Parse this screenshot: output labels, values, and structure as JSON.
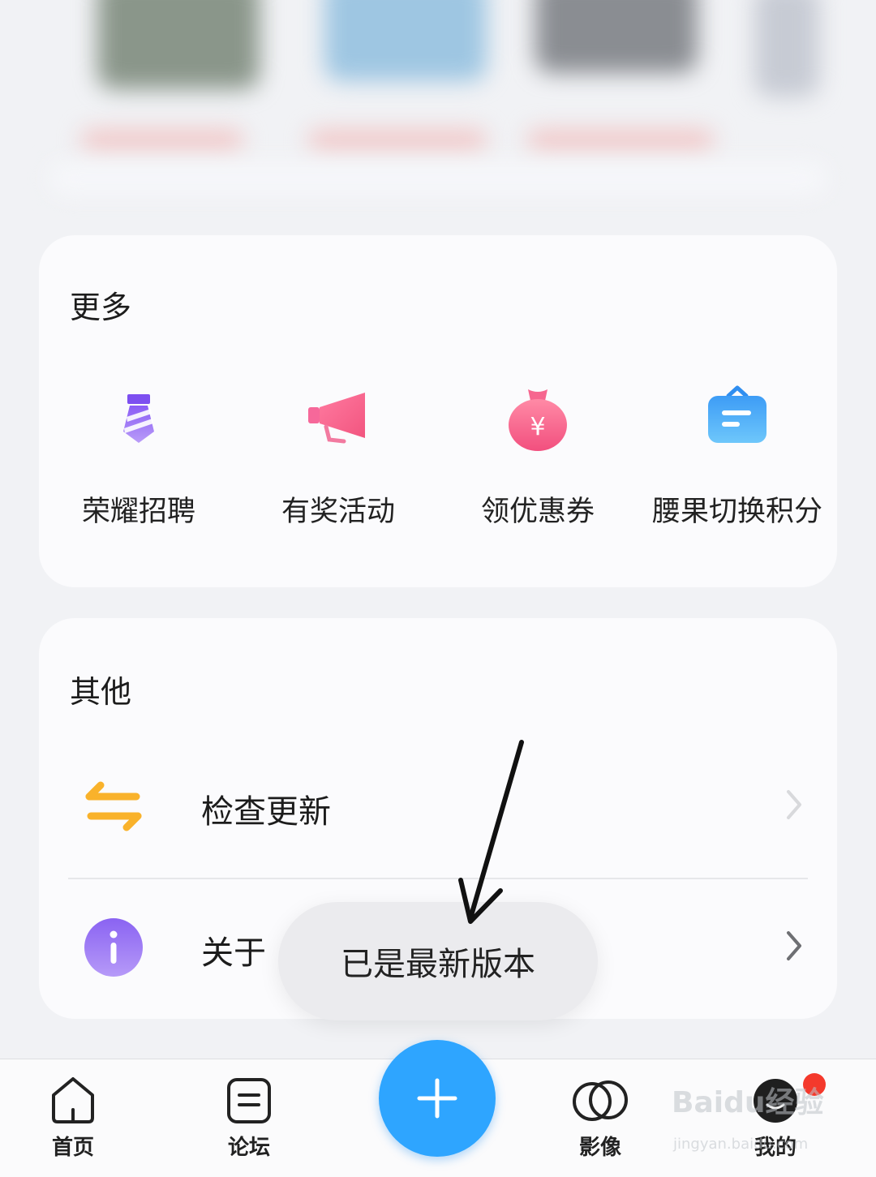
{
  "more": {
    "title": "更多",
    "items": [
      {
        "label": "荣耀招聘",
        "icon": "tie-icon"
      },
      {
        "label": "有奖活动",
        "icon": "megaphone-icon"
      },
      {
        "label": "领优惠券",
        "icon": "money-bag-icon"
      },
      {
        "label": "腰果切换积分",
        "icon": "bag-icon"
      }
    ]
  },
  "other": {
    "title": "其他",
    "rows": [
      {
        "label": "检查更新",
        "icon": "swap-arrows-icon"
      },
      {
        "label": "关于",
        "icon": "info-icon"
      }
    ]
  },
  "toast": {
    "text": "已是最新版本"
  },
  "tabbar": {
    "tabs": [
      {
        "label": "首页",
        "icon": "home-icon"
      },
      {
        "label": "论坛",
        "icon": "forum-icon"
      },
      {
        "label": "影像",
        "icon": "image-rings-icon"
      },
      {
        "label": "我的",
        "icon": "avatar-icon"
      }
    ],
    "fab_icon": "plus-icon"
  },
  "watermark": {
    "line1": "Baidu经验",
    "line2": "jingyan.baidu.com"
  },
  "colors": {
    "accent": "#2ea5ff",
    "badge": "#f4392c",
    "background": "#f1f2f5",
    "card": "#fbfbfd"
  }
}
